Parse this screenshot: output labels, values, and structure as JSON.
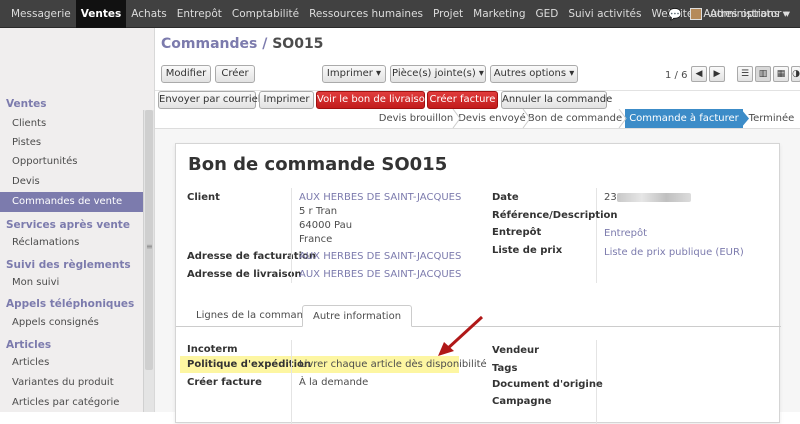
{
  "topbar": {
    "menu": [
      "Messagerie",
      "Ventes",
      "Achats",
      "Entrepôt",
      "Comptabilité",
      "Ressources humaines",
      "Projet",
      "Marketing",
      "GED",
      "Suivi activités",
      "Website",
      "Autres options ▾"
    ],
    "user": "Administrator ▾"
  },
  "sidebar": {
    "sections": [
      {
        "title": "Ventes",
        "items": [
          "Clients",
          "Pistes",
          "Opportunités",
          "Devis",
          "Commandes de vente"
        ]
      },
      {
        "title": "Services après vente",
        "items": [
          "Réclamations"
        ]
      },
      {
        "title": "Suivi des règlements",
        "items": [
          "Mon suivi"
        ]
      },
      {
        "title": "Appels téléphoniques",
        "items": [
          "Appels consignés"
        ]
      },
      {
        "title": "Articles",
        "items": [
          "Articles",
          "Variantes du produit",
          "Articles par catégorie"
        ]
      }
    ],
    "active": "Commandes de vente"
  },
  "breadcrumb": {
    "parent": "Commandes",
    "separator": "/",
    "current": "SO015"
  },
  "toolbar": {
    "edit": "Modifier",
    "create": "Créer",
    "print": "Imprimer ▾",
    "attachments": "Pièce(s) jointe(s) ▾",
    "more": "Autres options ▾",
    "pager": "1 / 6"
  },
  "actions": {
    "email": "Envoyer par courriel",
    "print": "Imprimer",
    "delivery": "Voir le bon de livraison",
    "invoice": "Créer facture",
    "cancel": "Annuler la commande"
  },
  "stages": [
    "Devis brouillon",
    "Devis envoyé",
    "Bon de commande",
    "Commande à facturer",
    "Terminée"
  ],
  "active_stage": "Commande à facturer",
  "form": {
    "title": "Bon de commande SO015",
    "client_label": "Client",
    "client_name": "AUX HERBES DE SAINT-JACQUES",
    "address1": "5 r Tran",
    "address2": "64000 Pau",
    "country": "France",
    "billing_label": "Adresse de facturation",
    "billing_value": "AUX HERBES DE SAINT-JACQUES",
    "shipping_label": "Adresse de livraison",
    "shipping_value": "AUX HERBES DE SAINT-JACQUES",
    "date_label": "Date",
    "date_value": "23",
    "ref_label": "Référence/Description",
    "warehouse_label": "Entrepôt",
    "warehouse_value": "Entrepôt",
    "pricelist_label": "Liste de prix",
    "pricelist_value": "Liste de prix publique (EUR)"
  },
  "tabs": [
    "Lignes de la commande",
    "Autre information"
  ],
  "other": {
    "incoterm": "Incoterm",
    "policy_label": "Politique d'expédition",
    "policy_value": "Livrer chaque article dès disponibilité",
    "invoice_label": "Créer facture",
    "invoice_value": "À la demande",
    "vendor": "Vendeur",
    "tags": "Tags",
    "origin": "Document d'origine",
    "campaign": "Campagne"
  },
  "colors": {
    "brand": "#7c7bad",
    "active_stage": "#3c8cc8",
    "red_button": "#c21c1c",
    "highlight": "#fdf6a2",
    "arrow": "#b01818"
  }
}
